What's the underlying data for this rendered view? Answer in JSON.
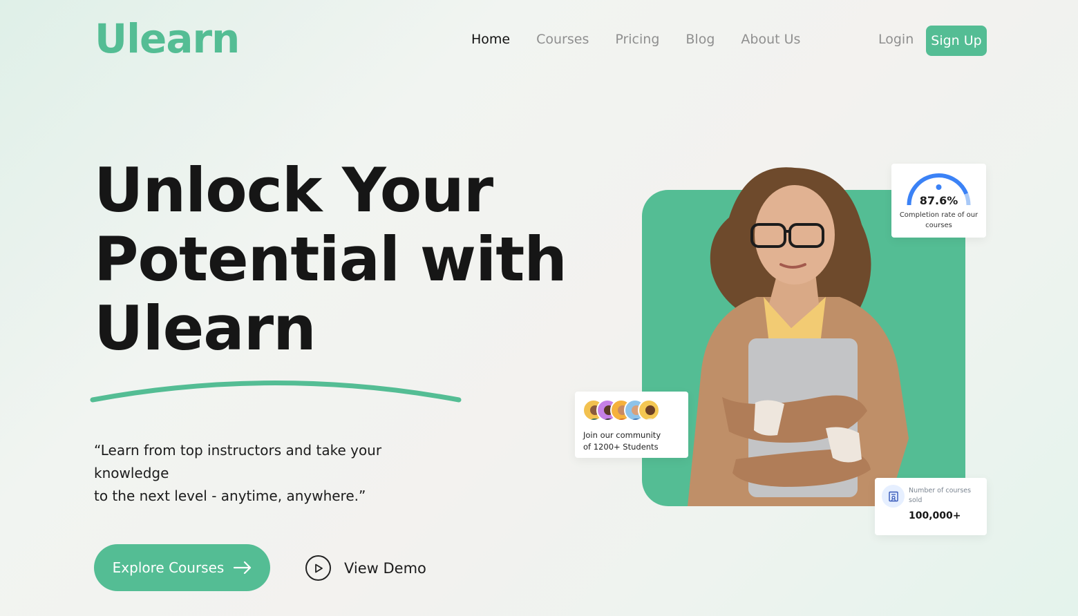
{
  "brand": {
    "name": "Ulearn"
  },
  "nav": {
    "items": [
      {
        "label": "Home",
        "active": true
      },
      {
        "label": "Courses",
        "active": false
      },
      {
        "label": "Pricing",
        "active": false
      },
      {
        "label": "Blog",
        "active": false
      },
      {
        "label": "About Us",
        "active": false
      }
    ],
    "login_label": "Login",
    "signup_label": "Sign Up"
  },
  "hero": {
    "title_lines": [
      "Unlock Your",
      "Potential with",
      "Ulearn"
    ],
    "quote_line1": "“Learn from top instructors and take your knowledge",
    "quote_line2": "to the next level - anytime, anywhere.”",
    "cta_primary": "Explore Courses",
    "cta_secondary": "View Demo"
  },
  "stats": {
    "completion": {
      "value": "87.6%",
      "value_fraction": 0.876,
      "caption": "Completion rate of our courses"
    },
    "community": {
      "line1": "Join our community",
      "line2": "of 1200+ Students"
    },
    "sold": {
      "label": "Number of courses sold",
      "value": "100,000+"
    }
  },
  "colors": {
    "accent": "#54bd94",
    "gauge": "#3b82f6",
    "gauge_light": "#a9c9f7",
    "text_dark": "#161616",
    "text_muted": "#8f8f8f"
  },
  "icons": [
    "arrow-right-icon",
    "play-icon",
    "certificate-icon"
  ]
}
